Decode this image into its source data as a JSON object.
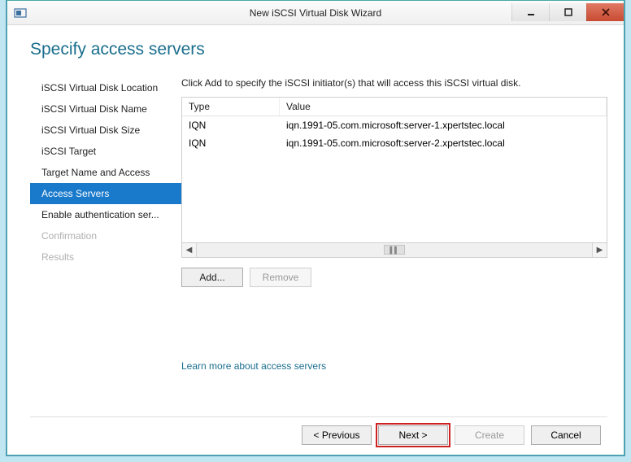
{
  "window": {
    "title": "New iSCSI Virtual Disk Wizard"
  },
  "page": {
    "heading": "Specify access servers"
  },
  "nav": {
    "items": [
      {
        "label": "iSCSI Virtual Disk Location",
        "state": "normal"
      },
      {
        "label": "iSCSI Virtual Disk Name",
        "state": "normal"
      },
      {
        "label": "iSCSI Virtual Disk Size",
        "state": "normal"
      },
      {
        "label": "iSCSI Target",
        "state": "normal"
      },
      {
        "label": "Target Name and Access",
        "state": "normal"
      },
      {
        "label": "Access Servers",
        "state": "selected"
      },
      {
        "label": "Enable authentication ser...",
        "state": "normal"
      },
      {
        "label": "Confirmation",
        "state": "disabled"
      },
      {
        "label": "Results",
        "state": "disabled"
      }
    ]
  },
  "main": {
    "instruction": "Click Add to specify the iSCSI initiator(s) that will access this iSCSI virtual disk.",
    "columns": {
      "type": "Type",
      "value": "Value"
    },
    "rows": [
      {
        "type": "IQN",
        "value": "iqn.1991-05.com.microsoft:server-1.xpertstec.local"
      },
      {
        "type": "IQN",
        "value": "iqn.1991-05.com.microsoft:server-2.xpertstec.local"
      }
    ],
    "add": "Add...",
    "remove": "Remove",
    "learn": "Learn more about access servers"
  },
  "footer": {
    "previous": "< Previous",
    "next": "Next >",
    "create": "Create",
    "cancel": "Cancel"
  }
}
